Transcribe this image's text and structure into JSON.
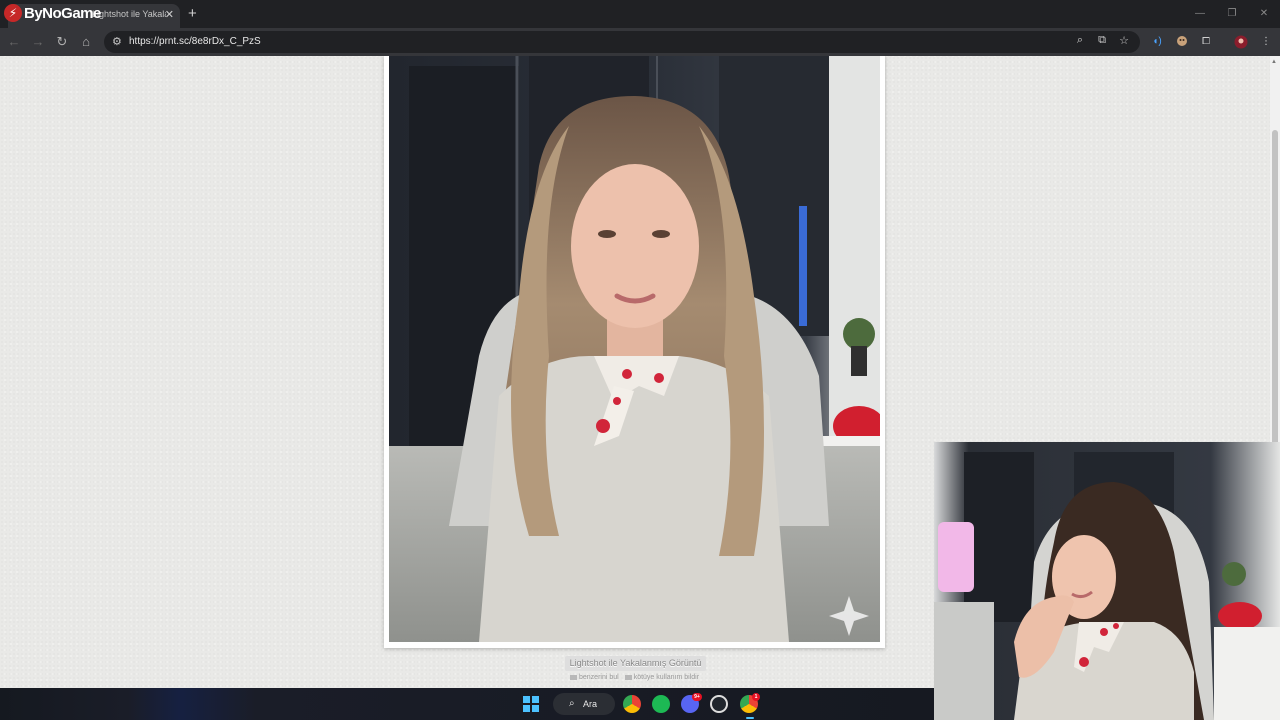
{
  "browser": {
    "brand_logo_text": "ByNoGame",
    "tab_title": "Lightshot ile Yakalanmış Ekran Görüntüsü",
    "new_tab_symbol": "+",
    "url": "https://prnt.sc/8e8rDx_C_PzS",
    "window_controls": [
      "—",
      "❐",
      "✕"
    ]
  },
  "page": {
    "caption": "Lightshot ile Yakalanmış Görüntü",
    "link_similar": "benzerini bul",
    "link_report": "kötüye kullanım bildir"
  },
  "taskbar": {
    "search_label": "Ara",
    "discord_badge": "9+",
    "chrome_badge": "1"
  },
  "colors": {
    "chrome_dark": "#202124",
    "chrome_toolbar": "#35363a",
    "page_bg": "#e9e9e7",
    "accent_red": "#c62828",
    "windows_blue": "#4cc2ff"
  },
  "icons": {
    "back": "arrow-left-icon",
    "forward": "arrow-right-icon",
    "reload": "reload-icon",
    "home": "home-icon",
    "site_info": "tune-icon",
    "zoom": "zoom-icon",
    "install": "install-app-icon",
    "bookmark": "star-icon",
    "extensions": "puzzle-icon",
    "menu": "kebab-menu-icon"
  }
}
